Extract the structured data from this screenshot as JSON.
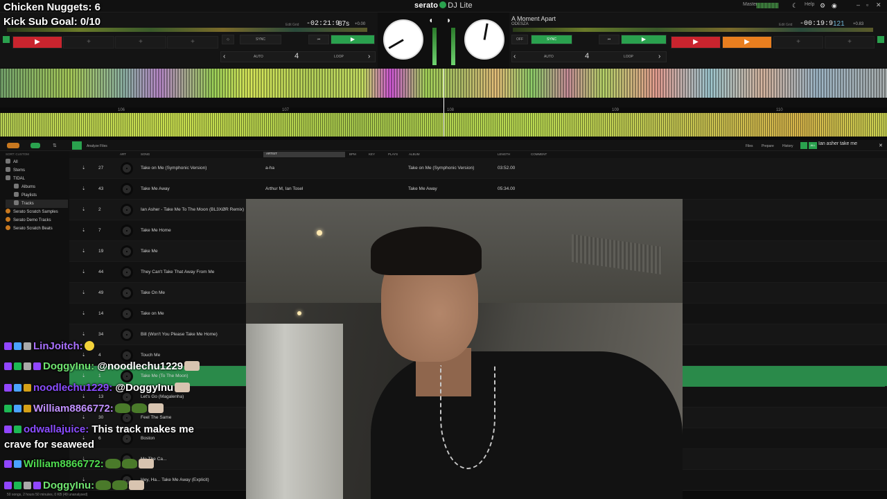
{
  "stream_overlay": {
    "nuggets": "Chicken Nuggets: 6",
    "kicksub": "Kick Sub Goal: 0/10"
  },
  "app": {
    "brand": "serato",
    "product": "DJ Lite",
    "master_label": "Master",
    "help_label": "Help"
  },
  "deck_left": {
    "time_label": "Edit Grid",
    "time": "-02:21:9",
    "bpm": "87s",
    "pitch": "+0.00",
    "sync": "SYNC",
    "auto": "AUTO",
    "loop": "LOOP",
    "beats": "4"
  },
  "deck_right": {
    "title": "A Moment Apart",
    "artist": "ODESZA",
    "time_label": "Edit Grid",
    "time": "-00:19:9",
    "bpm": "121",
    "pitch": "+0.83",
    "off": "OFF",
    "sync": "SYNC",
    "auto": "AUTO",
    "loop": "LOOP",
    "beats": "4"
  },
  "beat_markers": [
    "106",
    "107",
    "108",
    "109",
    "110"
  ],
  "library": {
    "toolbar": {
      "analyze": "Analyze Files",
      "files": "Files",
      "prepare": "Prepare",
      "history": "History",
      "all": "ALL"
    },
    "search_value": "Ian asher take me",
    "sort_label": "SORT: CUSTOM",
    "sidebar": [
      "All",
      "Stems",
      "TIDAL",
      "Albums",
      "Playlists",
      "Tracks",
      "Serato Scratch Samples",
      "Serato Demo Tracks",
      "Serato Scratch Beats"
    ],
    "columns": {
      "art": "ART",
      "song": "SONG",
      "artist": "ARTIST",
      "bpm": "BPM",
      "key": "KEY",
      "plays": "PLAYS",
      "album": "ALBUM",
      "length": "LENGTH",
      "comment": "COMMENT"
    },
    "rows": [
      {
        "num": "27",
        "song": "Take on Me (Symphonic Version)",
        "artist": "a-ha",
        "album": "Take on Me (Symphonic Version)",
        "length": "03:52.00"
      },
      {
        "num": "43",
        "song": "Take Me Away",
        "artist": "Arthur M, Ian Tosel",
        "album": "Take Me Away",
        "length": "05:34.00"
      },
      {
        "num": "2",
        "song": "Ian Asher - Take Me To The Moon (BL3XØR Remix)",
        "artist": "",
        "album": "",
        "length": ""
      },
      {
        "num": "7",
        "song": "Take Me Home",
        "artist": "",
        "album": "",
        "length": ""
      },
      {
        "num": "19",
        "song": "Take Me",
        "artist": "",
        "album": "",
        "length": ""
      },
      {
        "num": "44",
        "song": "They Can't Take That Away From Me",
        "artist": "",
        "album": "",
        "length": ""
      },
      {
        "num": "49",
        "song": "Take On Me",
        "artist": "",
        "album": "",
        "length": ""
      },
      {
        "num": "14",
        "song": "Take on Me",
        "artist": "",
        "album": "",
        "length": ""
      },
      {
        "num": "34",
        "song": "Bill (Won't You Please Take Me Home)",
        "artist": "",
        "album": "",
        "length": ""
      },
      {
        "num": "4",
        "song": "Touch Me",
        "artist": "",
        "album": "",
        "length": ""
      },
      {
        "num": "1",
        "song": "Take Me (To The Moon)",
        "artist": "",
        "album": "",
        "length": ""
      },
      {
        "num": "13",
        "song": "Let's Go (Magalenha)",
        "artist": "",
        "album": "",
        "length": ""
      },
      {
        "num": "30",
        "song": "Feel The Same",
        "artist": "",
        "album": "",
        "length": ""
      },
      {
        "num": "6",
        "song": "Boston",
        "artist": "",
        "album": "",
        "length": ""
      },
      {
        "num": "",
        "song": "Me The Ca...",
        "artist": "",
        "album": "",
        "length": ""
      },
      {
        "num": "",
        "song": "Hey, Ha... Take Me Away (Explicit)",
        "artist": "",
        "album": "",
        "length": ""
      }
    ],
    "status": "50 songs, 2 hours 50 minutes, 0 KB (49 unanalysed)"
  },
  "chat": [
    {
      "user": "LinJoitch:",
      "message": "",
      "user_class": "user-purple"
    },
    {
      "user": "DoggyInu:",
      "message": "@noodlechu1229",
      "user_class": "user-green"
    },
    {
      "user": "noodlechu1229:",
      "message": "@DoggyInu",
      "user_class": "user-purple2"
    },
    {
      "user": "William8866772:",
      "message": "",
      "user_class": "user-lav"
    },
    {
      "user": "odwallajuice:",
      "message": "This track makes me",
      "message2": "crave for seaweed",
      "user_class": "user-purple2"
    },
    {
      "user": "William8866772:",
      "message": "",
      "user_class": "user-green2"
    },
    {
      "user": "DoggyInu:",
      "message": "",
      "user_class": "user-green"
    }
  ]
}
